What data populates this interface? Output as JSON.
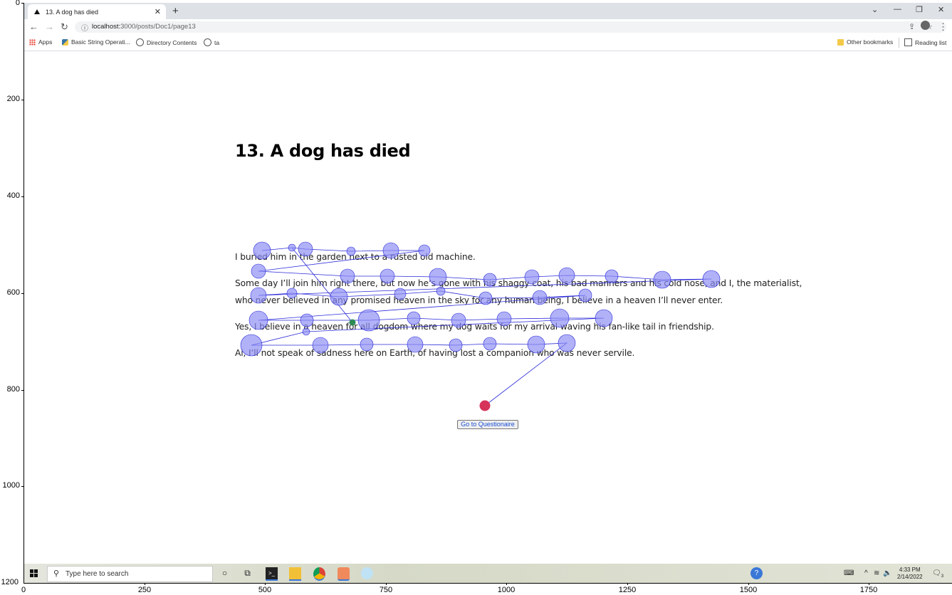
{
  "axes": {
    "y_ticks": [
      "0",
      "200",
      "400",
      "600",
      "800",
      "1000",
      "1200"
    ],
    "x_ticks": [
      "0",
      "250",
      "500",
      "750",
      "1000",
      "1250",
      "1500",
      "1750"
    ]
  },
  "browser": {
    "tab_title": "13. A dog has died",
    "close_glyph": "✕",
    "new_tab_glyph": "+",
    "url_host": "localhost:",
    "url_path": "3000/posts/Doc1/page13",
    "bookmarks": [
      "Apps",
      "Basic String Operati...",
      "Directory Contents",
      "ta"
    ],
    "other_bookmarks": "Other bookmarks",
    "reading_list": "Reading list"
  },
  "page": {
    "title": "13. A dog has died",
    "paragraphs": [
      "I buried him in the garden next to a rusted old machine.",
      "Some day I’ll join him right there, but now he’s gone with his shaggy coat, his bad manners and his cold nose, and I, the materialist,",
      "who never believed in any promised heaven in the sky for any human being, I believe in a heaven I’ll never enter.",
      "Yes, I believe in a heaven for all dogdom where my dog waits for my arrival waving his fan-like tail in friendship.",
      "Ai, I’ll not speak of sadness here on Earth, of having lost a companion who was never servile."
    ],
    "button": "Go to Questionaire"
  },
  "colors": {
    "fixation_fill": "#8c8cf5",
    "scanpath": "#2b2bd9",
    "start_point": "#2e8b57",
    "end_point": "#d6335a"
  },
  "taskbar": {
    "search_placeholder": "Type here to search",
    "time": "4:33 PM",
    "date": "2/14/2022",
    "notification_count": "3"
  }
}
